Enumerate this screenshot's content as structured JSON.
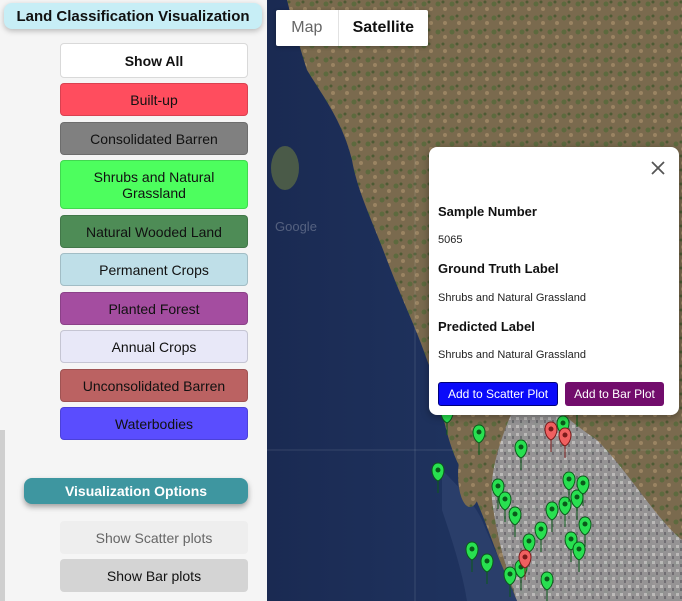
{
  "sidebar": {
    "title": "Land Classification Visualization",
    "class_buttons": [
      {
        "label": "Show All",
        "color": "#ffffff"
      },
      {
        "label": "Built-up",
        "color": "#ff4d5e"
      },
      {
        "label": "Consolidated Barren",
        "color": "#808080"
      },
      {
        "label": "Shrubs and Natural Grassland",
        "color": "#4dfe5e"
      },
      {
        "label": "Natural Wooded Land",
        "color": "#4e8c56"
      },
      {
        "label": "Permanent Crops",
        "color": "#bfdfe8"
      },
      {
        "label": "Planted Forest",
        "color": "#a44da0"
      },
      {
        "label": "Annual Crops",
        "color": "#e8e8f8"
      },
      {
        "label": "Unconsolidated Barren",
        "color": "#bb6262"
      },
      {
        "label": "Waterbodies",
        "color": "#5a4dfe"
      }
    ],
    "options_title": "Visualization Options",
    "scatter_label": "Show Scatter plots",
    "bar_label": "Show Bar plots"
  },
  "map": {
    "type_map": "Map",
    "type_satellite": "Satellite",
    "selected_type": "Satellite",
    "watermark": "Google"
  },
  "popup": {
    "sample_heading": "Sample Number",
    "sample_value": "5065",
    "truth_heading": "Ground Truth Label",
    "truth_value": "Shrubs and Natural Grassland",
    "pred_heading": "Predicted Label",
    "pred_value": "Shrubs and Natural Grassland",
    "scatter_button": "Add to Scatter Plot",
    "bar_button": "Add to Bar Plot",
    "scatter_button_color": "#0a0afa",
    "bar_button_color": "#720d6c"
  },
  "marker_colors": {
    "green": "#28e050",
    "red": "#f06060"
  }
}
